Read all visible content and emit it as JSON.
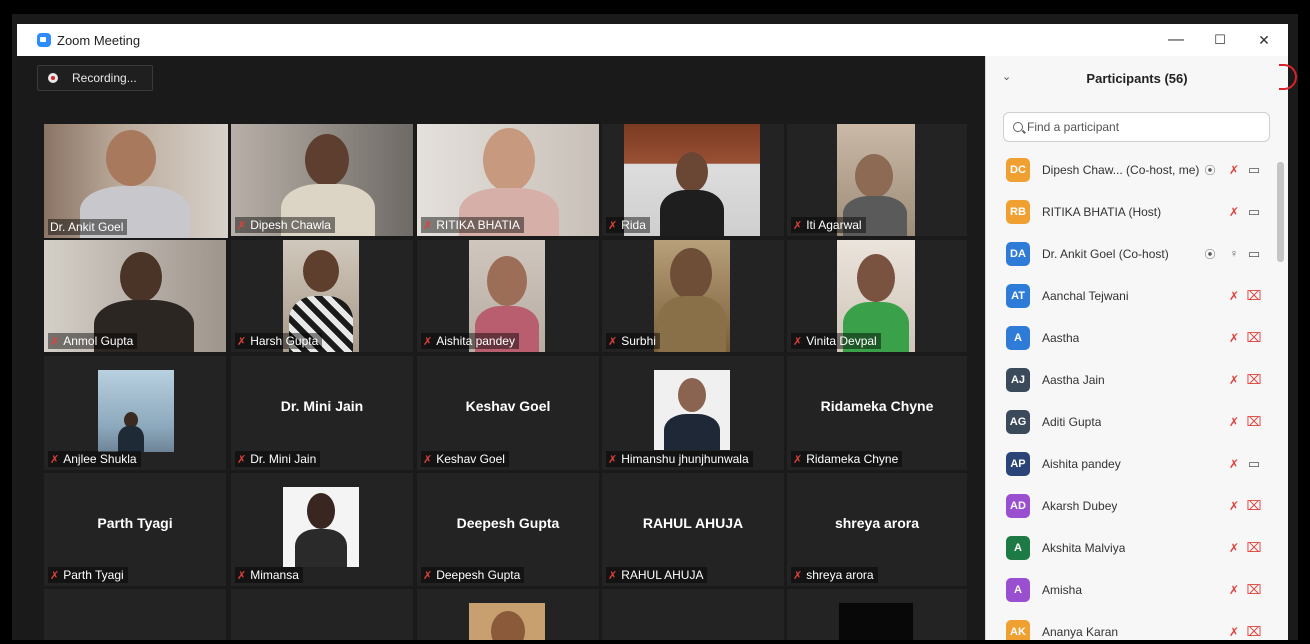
{
  "window": {
    "title": "Zoom Meeting",
    "minimize": "—",
    "maximize": "☐",
    "close": "✕"
  },
  "recording": {
    "label": "Recording..."
  },
  "tiles": [
    {
      "name": "Dr. Ankit Goel",
      "muted": false,
      "video": true,
      "active": true
    },
    {
      "name": "Dipesh Chawla",
      "muted": true,
      "video": true
    },
    {
      "name": "RITIKA BHATIA",
      "muted": true,
      "video": true
    },
    {
      "name": "Rida",
      "muted": true,
      "video": true
    },
    {
      "name": "Iti Agarwal",
      "muted": true,
      "video": true
    },
    {
      "name": "Anmol Gupta",
      "muted": true,
      "video": true
    },
    {
      "name": "Harsh Gupta",
      "muted": true,
      "video": true
    },
    {
      "name": "Aishita pandey",
      "muted": true,
      "video": true
    },
    {
      "name": "Surbhi",
      "muted": true,
      "video": true
    },
    {
      "name": "Vinita Devpal",
      "muted": true,
      "video": true
    },
    {
      "name": "Anjlee Shukla",
      "muted": true,
      "video": true
    },
    {
      "name": "Dr. Mini Jain",
      "muted": true,
      "video": false
    },
    {
      "name": "Keshav Goel",
      "muted": true,
      "video": false
    },
    {
      "name": "Himanshu jhunjhunwala",
      "muted": true,
      "video": true
    },
    {
      "name": "Ridameka Chyne",
      "muted": true,
      "video": false
    },
    {
      "name": "Parth Tyagi",
      "muted": true,
      "video": false
    },
    {
      "name": "Mimansa",
      "muted": true,
      "video": true
    },
    {
      "name": "Deepesh Gupta",
      "muted": true,
      "video": false
    },
    {
      "name": "RAHUL AHUJA",
      "muted": true,
      "video": false
    },
    {
      "name": "shreya arora",
      "muted": true,
      "video": false
    }
  ],
  "participants_panel": {
    "title": "Participants (56)",
    "search_placeholder": "Find a participant",
    "participants": [
      {
        "initials": "DC",
        "name": "Dipesh Chaw... (Co-host, me)",
        "color": "#f0a030",
        "recording": true,
        "mic": "muted",
        "cam": "on"
      },
      {
        "initials": "RB",
        "name": "RITIKA BHATIA (Host)",
        "color": "#f0a030",
        "recording": false,
        "mic": "muted",
        "cam": "on"
      },
      {
        "initials": "DA",
        "name": "Dr. Ankit Goel (Co-host)",
        "color": "#2f7bd8",
        "recording": true,
        "mic": "on",
        "cam": "on"
      },
      {
        "initials": "AT",
        "name": "Aanchal Tejwani",
        "color": "#2f7bd8",
        "recording": false,
        "mic": "muted",
        "cam": "off"
      },
      {
        "initials": "A",
        "name": "Aastha",
        "color": "#2f7bd8",
        "recording": false,
        "mic": "muted",
        "cam": "off"
      },
      {
        "initials": "AJ",
        "name": "Aastha Jain",
        "color": "#3a4a5a",
        "recording": false,
        "mic": "muted",
        "cam": "off"
      },
      {
        "initials": "AG",
        "name": "Aditi Gupta",
        "color": "#3a4a5a",
        "recording": false,
        "mic": "muted",
        "cam": "off"
      },
      {
        "initials": "AP",
        "name": "Aishita pandey",
        "color": "#2a4478",
        "recording": false,
        "mic": "muted",
        "cam": "on"
      },
      {
        "initials": "AD",
        "name": "Akarsh Dubey",
        "color": "#9a4ed0",
        "recording": false,
        "mic": "muted",
        "cam": "off"
      },
      {
        "initials": "A",
        "name": "Akshita Malviya",
        "color": "#1e7a45",
        "recording": false,
        "mic": "muted",
        "cam": "off"
      },
      {
        "initials": "A",
        "name": "Amisha",
        "color": "#9a4ed0",
        "recording": false,
        "mic": "muted",
        "cam": "off"
      },
      {
        "initials": "AK",
        "name": "Ananya Karan",
        "color": "#f0a030",
        "recording": false,
        "mic": "muted",
        "cam": "off"
      }
    ]
  }
}
